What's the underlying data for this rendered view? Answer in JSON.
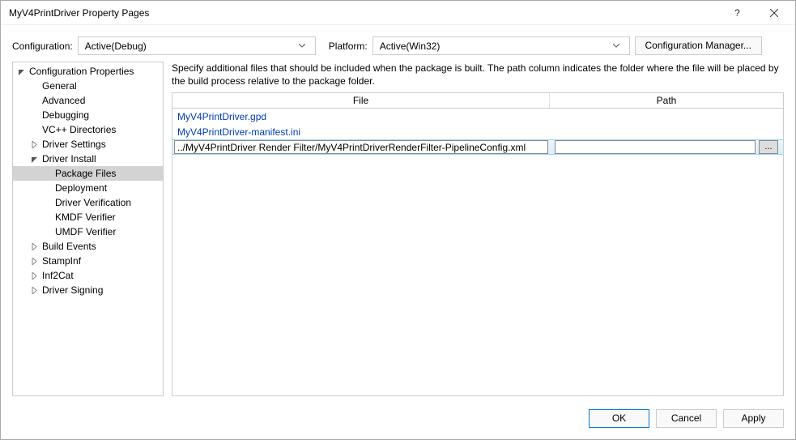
{
  "titlebar": {
    "title": "MyV4PrintDriver Property Pages"
  },
  "configbar": {
    "config_label": "Configuration:",
    "config_value": "Active(Debug)",
    "platform_label": "Platform:",
    "platform_value": "Active(Win32)",
    "cfg_manager_label": "Configuration Manager..."
  },
  "tree": [
    {
      "label": "Configuration Properties",
      "indent": 0,
      "exp": "open"
    },
    {
      "label": "General",
      "indent": 1,
      "exp": "none"
    },
    {
      "label": "Advanced",
      "indent": 1,
      "exp": "none"
    },
    {
      "label": "Debugging",
      "indent": 1,
      "exp": "none"
    },
    {
      "label": "VC++ Directories",
      "indent": 1,
      "exp": "none"
    },
    {
      "label": "Driver Settings",
      "indent": 1,
      "exp": "closed"
    },
    {
      "label": "Driver Install",
      "indent": 1,
      "exp": "open"
    },
    {
      "label": "Package Files",
      "indent": 2,
      "exp": "none",
      "selected": true
    },
    {
      "label": "Deployment",
      "indent": 2,
      "exp": "none"
    },
    {
      "label": "Driver Verification",
      "indent": 2,
      "exp": "none"
    },
    {
      "label": "KMDF Verifier",
      "indent": 2,
      "exp": "none"
    },
    {
      "label": "UMDF Verifier",
      "indent": 2,
      "exp": "none"
    },
    {
      "label": "Build Events",
      "indent": 1,
      "exp": "closed"
    },
    {
      "label": "StampInf",
      "indent": 1,
      "exp": "closed"
    },
    {
      "label": "Inf2Cat",
      "indent": 1,
      "exp": "closed"
    },
    {
      "label": "Driver Signing",
      "indent": 1,
      "exp": "closed"
    }
  ],
  "main": {
    "description": "Specify additional files that should be included when the package is built.  The path column indicates the folder where the file will be placed by the build process relative to the package folder.",
    "col_file": "File",
    "col_path": "Path",
    "rows": [
      {
        "file": "MyV4PrintDriver.gpd",
        "path": "",
        "editing": false
      },
      {
        "file": "MyV4PrintDriver-manifest.ini",
        "path": "",
        "editing": false
      },
      {
        "file": "../MyV4PrintDriver Render Filter/MyV4PrintDriverRenderFilter-PipelineConfig.xml",
        "path": "",
        "editing": true
      }
    ],
    "browse_label": "..."
  },
  "footer": {
    "ok": "OK",
    "cancel": "Cancel",
    "apply": "Apply"
  }
}
